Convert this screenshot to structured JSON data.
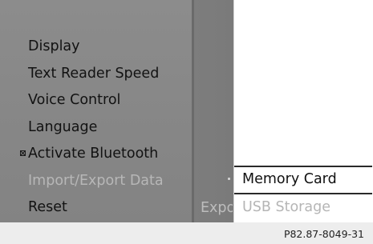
{
  "menu": {
    "items": [
      {
        "label": "Display"
      },
      {
        "label": "Text Reader Speed"
      },
      {
        "label": "Voice Control"
      },
      {
        "label": "Language"
      },
      {
        "label": "Activate Bluetooth"
      },
      {
        "label": "Import/Export Data"
      },
      {
        "label": "Reset"
      }
    ],
    "bluetooth_checkbox_icon": "checkbox-checked-icon"
  },
  "submenu": {
    "partial_label": "Expo",
    "arrow_icon": "submenu-arrow-icon"
  },
  "popup": {
    "items": [
      {
        "label": "Memory Card",
        "state": "selected"
      },
      {
        "label": "USB Storage",
        "state": "disabled"
      }
    ]
  },
  "caption": "P82.87-8049-31",
  "colors": {
    "screen_background": "#878787",
    "popup_background": "#ffffff",
    "dimmed_text": "#b7b7b7"
  }
}
